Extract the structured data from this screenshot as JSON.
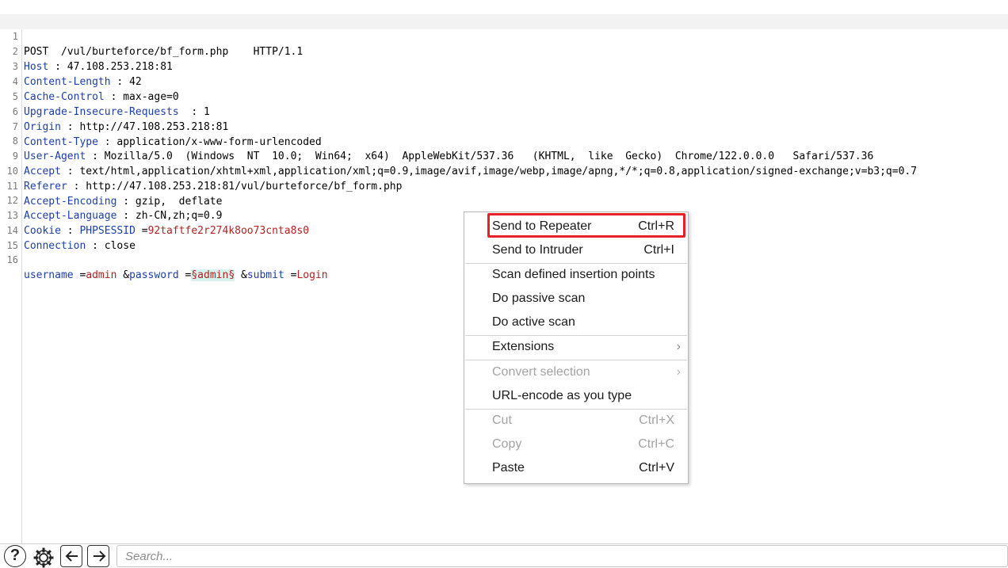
{
  "request": {
    "line_numbers": [
      "1",
      "2",
      "3",
      "4",
      "5",
      "6",
      "7",
      "8",
      "9",
      "10",
      "11",
      "12",
      "13",
      "14",
      "15",
      "16"
    ],
    "request_line": "POST  /vul/burteforce/bf_form.php    HTTP/1.1",
    "headers": [
      {
        "name": "Host",
        "sep": " : ",
        "value": "47.108.253.218:81"
      },
      {
        "name": "Content-Length",
        "sep": " : ",
        "value": "42"
      },
      {
        "name": "Cache-Control",
        "sep": " : ",
        "value": "max-age=0"
      },
      {
        "name": "Upgrade-Insecure-Requests",
        "sep": "  : ",
        "value": "1"
      },
      {
        "name": "Origin",
        "sep": " : ",
        "value": "http://47.108.253.218:81"
      },
      {
        "name": "Content-Type",
        "sep": " : ",
        "value": "application/x-www-form-urlencoded"
      },
      {
        "name": "User-Agent",
        "sep": " : ",
        "value": "Mozilla/5.0  (Windows  NT  10.0;  Win64;  x64)  AppleWebKit/537.36   (KHTML,  like  Gecko)  Chrome/122.0.0.0   Safari/537.36"
      },
      {
        "name": "Accept",
        "sep": " : ",
        "value": "text/html,application/xhtml+xml,application/xml;q=0.9,image/avif,image/webp,image/apng,*/*;q=0.8,application/signed-exchange;v=b3;q=0.7"
      },
      {
        "name": "Referer",
        "sep": " : ",
        "value": "http://47.108.253.218:81/vul/burteforce/bf_form.php"
      },
      {
        "name": "Accept-Encoding",
        "sep": " : ",
        "value": "gzip,  deflate"
      },
      {
        "name": "Accept-Language",
        "sep": " : ",
        "value": "zh-CN,zh;q=0.9"
      },
      {
        "name": "Cookie",
        "sep": " : ",
        "value": ""
      },
      {
        "name": "Connection",
        "sep": " : ",
        "value": "close"
      }
    ],
    "cookie": {
      "name": "PHPSESSID",
      "eq": " =",
      "value": "92taftfe2r274k8oo73cnta8s0"
    },
    "body": {
      "p1_name": "username",
      "p1_eq": " =",
      "p1_value": "admin",
      "amp1": " &",
      "p2_name": "password",
      "p2_eq": " =",
      "p2_value": "§admin§",
      "amp2": " &",
      "p3_name": "submit",
      "p3_eq": " =",
      "p3_value": "Login"
    }
  },
  "context_menu": {
    "items": [
      {
        "label": "Send to Repeater",
        "shortcut": "Ctrl+R"
      },
      {
        "label": "Send to Intruder",
        "shortcut": "Ctrl+I"
      },
      {
        "label": "Scan defined insertion points",
        "shortcut": ""
      },
      {
        "label": "Do passive scan",
        "shortcut": ""
      },
      {
        "label": "Do active scan",
        "shortcut": ""
      },
      {
        "label": "Extensions",
        "shortcut": ""
      },
      {
        "label": "Convert selection",
        "shortcut": ""
      },
      {
        "label": "URL-encode as you type",
        "shortcut": ""
      },
      {
        "label": "Cut",
        "shortcut": "Ctrl+X"
      },
      {
        "label": "Copy",
        "shortcut": "Ctrl+C"
      },
      {
        "label": "Paste",
        "shortcut": "Ctrl+V"
      }
    ],
    "highlight_color": "#e8202a"
  },
  "toolbar": {
    "help_label": "?",
    "search_placeholder": "Search...",
    "icons": [
      "help-icon",
      "settings-gear-icon",
      "arrow-left-icon",
      "arrow-right-icon"
    ]
  }
}
